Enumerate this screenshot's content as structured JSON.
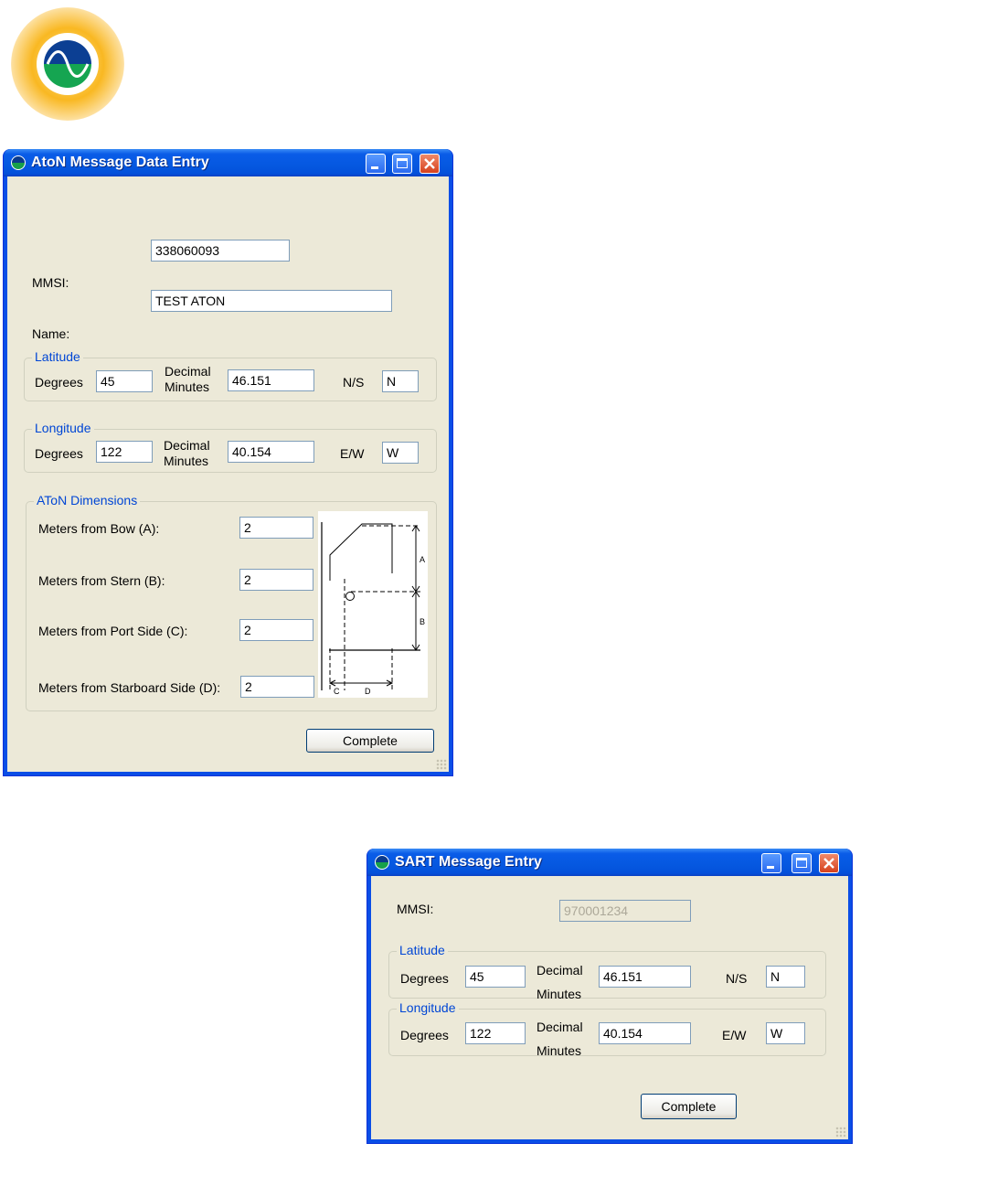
{
  "aton_window": {
    "title": "AtoN Message Data Entry",
    "mmsi_label": "MMSI:",
    "mmsi_value": "338060093",
    "name_label": "Name:",
    "name_value": "TEST ATON",
    "latitude": {
      "group_title": "Latitude",
      "degrees_label": "Degrees",
      "degrees_value": "45",
      "decimal_label": "Decimal",
      "minutes_label": "Minutes",
      "minutes_value": "46.151",
      "hemisphere_label": "N/S",
      "hemisphere_value": "N"
    },
    "longitude": {
      "group_title": "Longitude",
      "degrees_label": "Degrees",
      "degrees_value": "122",
      "decimal_label": "Decimal",
      "minutes_label": "Minutes",
      "minutes_value": "40.154",
      "hemisphere_label": "E/W",
      "hemisphere_value": "W"
    },
    "dimensions": {
      "group_title": "AToN Dimensions",
      "bow_label": "Meters from Bow (A):",
      "bow_value": "2",
      "stern_label": "Meters from Stern (B):",
      "stern_value": "2",
      "port_label": "Meters from Port Side (C):",
      "port_value": "2",
      "starboard_label": "Meters from Starboard Side (D):",
      "starboard_value": "2",
      "diagram_labels": {
        "a": "A",
        "b": "B",
        "c": "C",
        "d": "D"
      }
    },
    "complete_label": "Complete"
  },
  "sart_window": {
    "title": "SART Message Entry",
    "mmsi_label": "MMSI:",
    "mmsi_value": "970001234",
    "latitude": {
      "group_title": "Latitude",
      "degrees_label": "Degrees",
      "degrees_value": "45",
      "decimal_label": "Decimal",
      "minutes_label": "Minutes",
      "minutes_value": "46.151",
      "hemisphere_label": "N/S",
      "hemisphere_value": "N"
    },
    "longitude": {
      "group_title": "Longitude",
      "degrees_label": "Degrees",
      "degrees_value": "122",
      "decimal_label": "Decimal",
      "minutes_label": "Minutes",
      "minutes_value": "40.154",
      "hemisphere_label": "E/W",
      "hemisphere_value": "W"
    },
    "complete_label": "Complete"
  },
  "colors": {
    "titlebar": "#0558e0",
    "client": "#ece9d8",
    "group_title": "#0046d5",
    "logo_ring": "#f9b822"
  }
}
